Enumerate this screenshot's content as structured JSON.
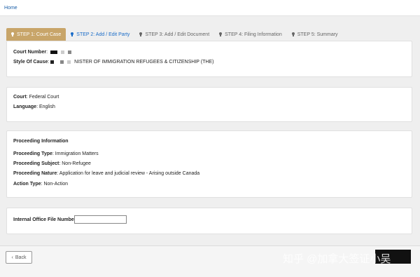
{
  "breadcrumb": {
    "home": "Home"
  },
  "tabs": [
    {
      "label": "STEP 1: Court Case",
      "state": "active"
    },
    {
      "label": "STEP 2: Add / Edit Party",
      "state": "link"
    },
    {
      "label": "STEP 3: Add / Edit Document",
      "state": "inactive"
    },
    {
      "label": "STEP 4: Filing Information",
      "state": "inactive"
    },
    {
      "label": "STEP 5: Summary",
      "state": "inactive"
    }
  ],
  "case": {
    "court_number_label": "Court Number",
    "style_of_cause_label": "Style Of Cause",
    "style_of_cause_value": "NISTER OF IMMIGRATION REFUGEES & CITIZENSHIP (THE)"
  },
  "court": {
    "court_label": "Court",
    "court_value": "Federal Court",
    "language_label": "Language",
    "language_value": "English"
  },
  "proceeding": {
    "heading": "Proceeding Information",
    "type_label": "Proceeding Type",
    "type_value": "Immigration Matters",
    "subject_label": "Proceeding Subject",
    "subject_value": "Non-Refugee",
    "nature_label": "Proceeding Nature",
    "nature_value": "Application for leave and judicial review - Arising outside Canada",
    "action_label": "Action Type",
    "action_value": "Non-Action"
  },
  "office": {
    "file_number_label": "Internal Office File Number",
    "file_number_value": ""
  },
  "footer": {
    "back_label": "Back"
  },
  "watermark": {
    "text": "知乎 @加拿大签证小吴"
  },
  "colors": {
    "active_tab": "#c8a569",
    "link": "#1a6cc8"
  }
}
